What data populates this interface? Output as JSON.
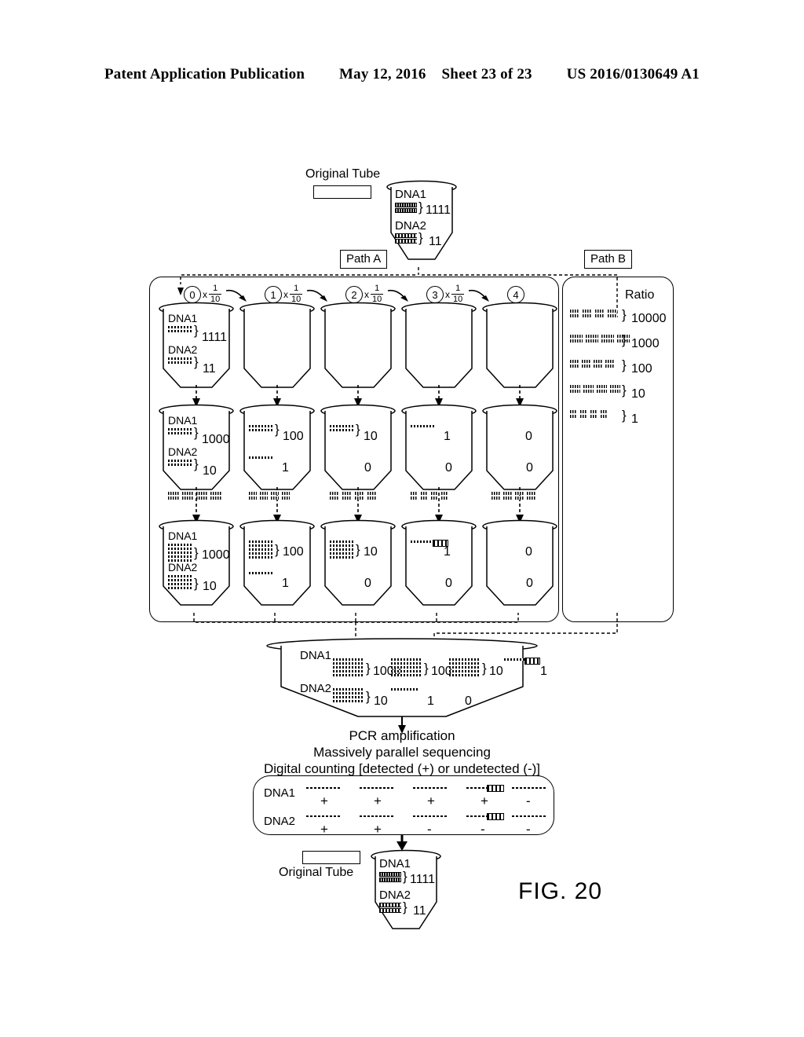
{
  "header": {
    "publication": "Patent Application Publication",
    "date": "May 12, 2016",
    "sheet": "Sheet 23 of 23",
    "patent_number": "US 2016/0130649 A1"
  },
  "figure": {
    "caption": "FIG. 20",
    "top": {
      "original_tube_label": "Original Tube",
      "tube": {
        "dna1_label": "DNA1",
        "dna1_count": "1111",
        "dna2_label": "DNA2",
        "dna2_count": "11"
      }
    },
    "paths": {
      "path_a_label": "Path A",
      "path_b_label": "Path B"
    },
    "dilution": {
      "steps": [
        "0",
        "1",
        "2",
        "3",
        "4"
      ],
      "factor_multiply": "x",
      "factor_numerator": "1",
      "factor_denominator": "10"
    },
    "row1": {
      "dna1_label": "DNA1",
      "dna2_label": "DNA2",
      "tubes": [
        {
          "dna1": "1111",
          "dna2": "11",
          "has_bands": true
        },
        {
          "dna1": "",
          "dna2": "",
          "has_bands": false
        },
        {
          "dna1": "",
          "dna2": "",
          "has_bands": false
        },
        {
          "dna1": "",
          "dna2": "",
          "has_bands": false
        },
        {
          "dna1": "",
          "dna2": "",
          "has_bands": false
        }
      ]
    },
    "row2": {
      "dna1_label": "DNA1",
      "dna2_label": "DNA2",
      "tubes": [
        {
          "dna1": "1000",
          "dna2": "10"
        },
        {
          "dna1": "100",
          "dna2": "1"
        },
        {
          "dna1": "10",
          "dna2": "0"
        },
        {
          "dna1": "1",
          "dna2": "0"
        },
        {
          "dna1": "0",
          "dna2": "0"
        }
      ]
    },
    "row3": {
      "dna1_label": "DNA1",
      "dna2_label": "DNA2",
      "tubes": [
        {
          "dna1": "1000",
          "dna2": "10"
        },
        {
          "dna1": "100",
          "dna2": "1"
        },
        {
          "dna1": "10",
          "dna2": "0"
        },
        {
          "dna1": "1",
          "dna2": "0"
        },
        {
          "dna1": "0",
          "dna2": "0"
        }
      ]
    },
    "path_b": {
      "ratio_header": "Ratio",
      "ratios": [
        "10000",
        "1000",
        "100",
        "10",
        "1"
      ]
    },
    "pool": {
      "dna1_label": "DNA1",
      "dna2_label": "DNA2",
      "dna1_values": [
        "1000",
        "100",
        "10",
        "1"
      ],
      "dna2_values": [
        "10",
        "1",
        "0"
      ]
    },
    "process": {
      "line1": "PCR amplification",
      "line2": "Massively parallel sequencing",
      "line3": "Digital counting [detected (+) or undetected (-)]"
    },
    "results": {
      "dna1_label": "DNA1",
      "dna2_label": "DNA2",
      "dna1_calls": [
        "+",
        "+",
        "+",
        "+",
        "-"
      ],
      "dna2_calls": [
        "+",
        "+",
        "-",
        "-",
        "-"
      ]
    },
    "bottom": {
      "original_tube_label": "Original Tube",
      "tube": {
        "dna1_label": "DNA1",
        "dna1_count": "1111",
        "dna2_label": "DNA2",
        "dna2_count": "11"
      }
    }
  }
}
